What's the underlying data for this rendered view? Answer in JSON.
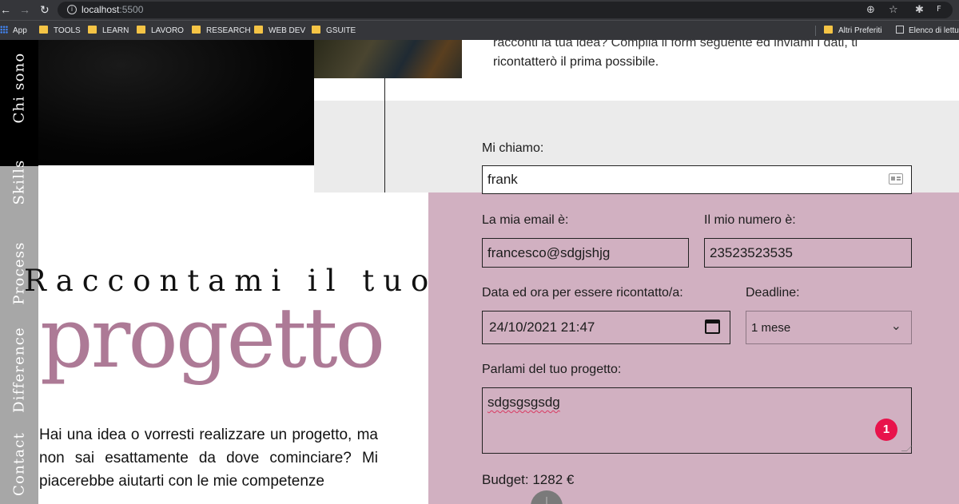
{
  "browser": {
    "url_host": "localhost",
    "url_port": ":5500",
    "bookmarks": [
      "App",
      "TOOLS",
      "LEARN",
      "LAVORO",
      "RESEARCH",
      "WEB DEV",
      "GSUITE"
    ],
    "other_bookmarks": "Altri Preferiti",
    "reading_list": "Elenco di lettu",
    "profile_initial": "F"
  },
  "sidenav": {
    "items": [
      "Chi sono",
      "Skills",
      "Process",
      "Difference",
      "Contact"
    ]
  },
  "top_text": {
    "line1": "racconti la tua idea? Compila il form seguente ed inviami i dati, ti",
    "line2": "ricontatterò il prima possibile."
  },
  "hero": {
    "title_small": "Raccontami il tuo",
    "title_big": "progetto",
    "intro": "Hai una idea o vorresti realizzare un progetto, ma non sai esattamente da dove cominciare? Mi piacerebbe aiutarti con le mie competenze"
  },
  "form": {
    "name_label": "Mi chiamo:",
    "name_value": "frank",
    "email_label": "La mia email è:",
    "email_value": "francesco@sdgjshjg",
    "phone_label": "Il mio numero è:",
    "phone_value": "23523523535",
    "datetime_label": "Data ed ora per essere ricontatto/a:",
    "datetime_value": "24/10/2021 21:47",
    "deadline_label": "Deadline:",
    "deadline_value": "1 mese",
    "project_label": "Parlami del tuo progetto:",
    "project_value": "sdgsgsgsdg",
    "badge_count": "1",
    "budget_label": "Budget: 1282 €"
  },
  "colors": {
    "accent_pink": "#ad7a96",
    "panel_pink": "#d1b0c1",
    "badge_red": "#e8134b"
  }
}
